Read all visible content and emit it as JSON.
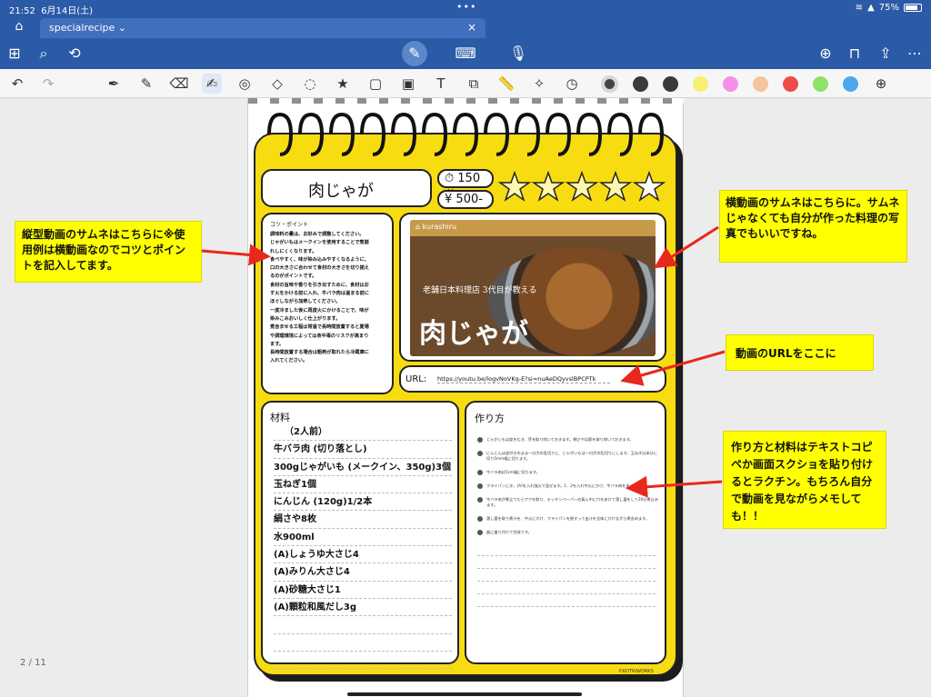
{
  "status_bar": {
    "time": "21:52",
    "date": "6月14日(土)",
    "battery": "75%"
  },
  "tab": {
    "title": "specialrecipe",
    "close": "×"
  },
  "drawing_toolbar": {
    "colors": [
      "#444444",
      "#3a3a3a",
      "#3a3a3a",
      "#f5f06e",
      "#f78fe8",
      "#f4c59c",
      "#f04a4a",
      "#8ee26a",
      "#4aa7ef"
    ]
  },
  "recipe": {
    "title": "肉じゃが",
    "time": "150分",
    "price": "500-",
    "price_symbol": "¥",
    "tips_title": "コツ・ポイント",
    "tips_lines": [
      "調味料の量は、お好みで調整してください。",
      "じゃがいもはメークインを使用することで煮崩",
      "れしにくくなります。",
      "食べやすく、味が染み込みやすくなるように、",
      "口の大きさに合わせて食材の大きさを切り揃え",
      "るのがポイントです。",
      "食材の旨味や香りを引き出すために、食材はお",
      "す火をかける前に入れ、牛バラ肉は温まる前に",
      "ほぐしながら加熱してください。",
      "一度冷ました後に再度火にかけることで、味が",
      "染みこみおいしく仕上がります。",
      "煮含ませる工程は常温で長時間放置すると夏場",
      "や調理環境によっては食中毒のリスクが高まり",
      "ます。",
      "長時間放置する場合は粗熱が取れたら冷蔵庫に",
      "入れてください。"
    ],
    "video": {
      "brand": "kurashiru",
      "subtitle": "老舗日本料理店 3代目が教える",
      "overlay_title": "肉じゃが"
    },
    "url_label": "URL:",
    "url": "https://youtu.be/logvNoVKq-E?si=nuAeDQyvslBPCPTk",
    "ingredients_title": "材料",
    "ingredients": [
      "（2人前）",
      "牛バラ肉 (切り落とし)",
      "300gじゃがいも (メークイン、350g)3個",
      "玉ねぎ1個",
      "にんじん (120g)1/2本",
      "絹さや8枚",
      "水900ml",
      "(A)しょうゆ大さじ4",
      "(A)みりん大さじ4",
      "(A)砂糖大さじ1",
      "(A)顆粒和風だし3g"
    ],
    "steps_title": "作り方",
    "steps": [
      "じゃがいもは皮をむき、芽を取り除いておきます。絹さやは筋を取り除いておきます。",
      "にんじんは皮付きのまま一口大の乱切りに、じゃがいもは一口大の乱切りにします。玉ねぎは半分に切り5mm幅に切ります。",
      "牛バラ肉は5cm幅に切ります。",
      "フライパンに水、(A)を入れ強火で混ぜます。1、2を入れ中火にかけ、牛バラ肉を並べます。",
      "牛バラ肉が煮立てたらアクを取り、キッチンペーパーの真ん中に穴をあけて落し蓋をして20分煮込みます。",
      "落し蓋を取り煮汁を、中火にかけ、フライパンを揺すって出汁を全体にかけながら煮含めます。",
      "器に盛り付けて完成です。"
    ],
    "credit": "©KOTRIWORKS"
  },
  "annotations": {
    "note_thumbnail_vertical": "縦型動画のサムネはこちらに※使用例は横動画なのでコツとポイントを記入してます。",
    "note_thumbnail_horizontal": "横動画のサムネはこちらに。サムネじゃなくても自分が作った料理の写真でもいいですね。",
    "note_url": "動画のURLをここに",
    "note_ingredients": "作り方と材料はテキストコピペか画面スクショを貼り付けるとラクチン。もちろん自分で動画を見ながらメモしても！！"
  },
  "page_indicator": "2 / 11"
}
